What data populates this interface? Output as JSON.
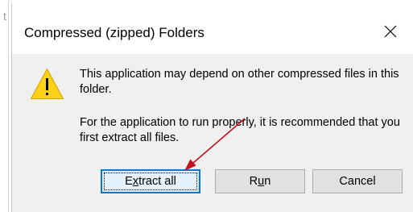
{
  "background": {
    "edge_char": "t"
  },
  "dialog": {
    "title": "Compressed (zipped) Folders",
    "close_icon": "close-icon",
    "warning_icon": "warning-icon",
    "message_primary": "This application may depend on other compressed files in this folder.",
    "message_secondary": "For the application to run properly, it is recommended that you first extract all files.",
    "buttons": {
      "extract_all": {
        "before": "E",
        "accel": "x",
        "after": "tract all"
      },
      "run": {
        "before": "R",
        "accel": "u",
        "after": "n"
      },
      "cancel": {
        "label": "Cancel"
      }
    }
  },
  "annotation": {
    "type": "arrow",
    "color": "#c0141c",
    "target": "extract-all-button"
  },
  "colors": {
    "content_bg": "#f0f0f0",
    "button_bg": "#e1e1e1",
    "focus_border": "#0078d7",
    "warning_yellow": "#fcd116"
  }
}
